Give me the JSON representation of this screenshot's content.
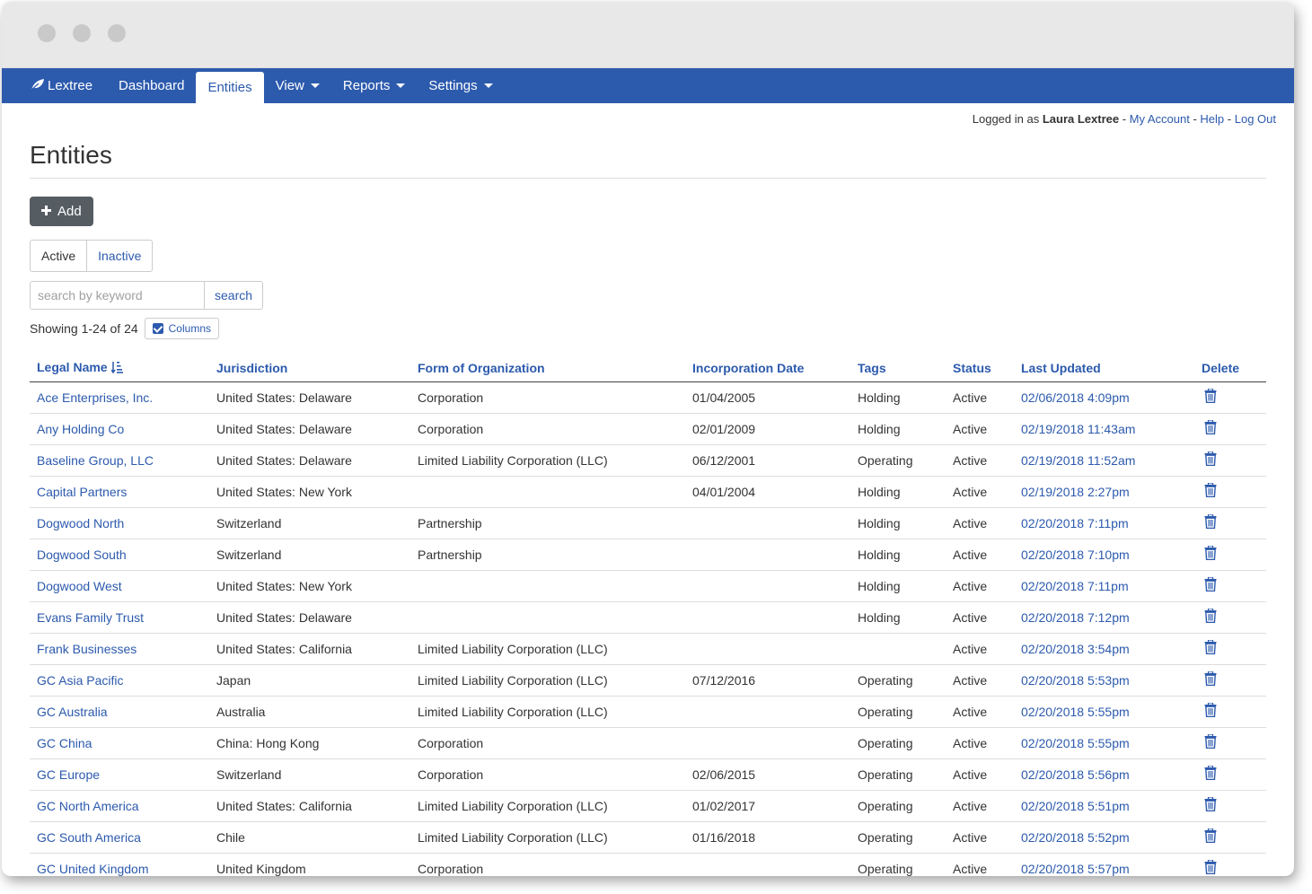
{
  "brand": {
    "name": "Lextree",
    "icon": "leaf-icon"
  },
  "nav": {
    "items": [
      {
        "label": "Dashboard",
        "dropdown": false,
        "active": false
      },
      {
        "label": "Entities",
        "dropdown": false,
        "active": true
      },
      {
        "label": "View",
        "dropdown": true,
        "active": false
      },
      {
        "label": "Reports",
        "dropdown": true,
        "active": false
      },
      {
        "label": "Settings",
        "dropdown": true,
        "active": false
      }
    ]
  },
  "userbar": {
    "prefix": "Logged in as",
    "user": "Laura Lextree",
    "sep1": " - ",
    "my_account": "My Account",
    "sep2": " - ",
    "help": "Help",
    "sep3": " - ",
    "logout": "Log Out"
  },
  "page": {
    "title": "Entities"
  },
  "toolbar": {
    "add_label": "Add",
    "filter_active": "Active",
    "filter_inactive": "Inactive",
    "search_placeholder": "search by keyword",
    "search_value": "",
    "search_button": "search",
    "showing": "Showing 1-24 of 24",
    "columns_label": "Columns"
  },
  "colors": {
    "primary": "#2c5aad",
    "add_button": "#555c62"
  },
  "table": {
    "headers": {
      "legal_name": "Legal Name",
      "jurisdiction": "Jurisdiction",
      "form": "Form of Organization",
      "incorporation_date": "Incorporation Date",
      "tags": "Tags",
      "status": "Status",
      "last_updated": "Last Updated",
      "delete": "Delete"
    },
    "rows": [
      {
        "name": "Ace Enterprises, Inc.",
        "jurisdiction": "United States: Delaware",
        "form": "Corporation",
        "date": "01/04/2005",
        "tags": "Holding",
        "status": "Active",
        "updated": "02/06/2018 4:09pm"
      },
      {
        "name": "Any Holding Co",
        "jurisdiction": "United States: Delaware",
        "form": "Corporation",
        "date": "02/01/2009",
        "tags": "Holding",
        "status": "Active",
        "updated": "02/19/2018 11:43am"
      },
      {
        "name": "Baseline Group, LLC",
        "jurisdiction": "United States: Delaware",
        "form": "Limited Liability Corporation (LLC)",
        "date": "06/12/2001",
        "tags": "Operating",
        "status": "Active",
        "updated": "02/19/2018 11:52am"
      },
      {
        "name": "Capital Partners",
        "jurisdiction": "United States: New York",
        "form": "",
        "date": "04/01/2004",
        "tags": "Holding",
        "status": "Active",
        "updated": "02/19/2018 2:27pm"
      },
      {
        "name": "Dogwood North",
        "jurisdiction": "Switzerland",
        "form": "Partnership",
        "date": "",
        "tags": "Holding",
        "status": "Active",
        "updated": "02/20/2018 7:11pm"
      },
      {
        "name": "Dogwood South",
        "jurisdiction": "Switzerland",
        "form": "Partnership",
        "date": "",
        "tags": "Holding",
        "status": "Active",
        "updated": "02/20/2018 7:10pm"
      },
      {
        "name": "Dogwood West",
        "jurisdiction": "United States: New York",
        "form": "",
        "date": "",
        "tags": "Holding",
        "status": "Active",
        "updated": "02/20/2018 7:11pm"
      },
      {
        "name": "Evans Family Trust",
        "jurisdiction": "United States: Delaware",
        "form": "",
        "date": "",
        "tags": "Holding",
        "status": "Active",
        "updated": "02/20/2018 7:12pm"
      },
      {
        "name": "Frank Businesses",
        "jurisdiction": "United States: California",
        "form": "Limited Liability Corporation (LLC)",
        "date": "",
        "tags": "",
        "status": "Active",
        "updated": "02/20/2018 3:54pm"
      },
      {
        "name": "GC Asia Pacific",
        "jurisdiction": "Japan",
        "form": "Limited Liability Corporation (LLC)",
        "date": "07/12/2016",
        "tags": "Operating",
        "status": "Active",
        "updated": "02/20/2018 5:53pm"
      },
      {
        "name": "GC Australia",
        "jurisdiction": "Australia",
        "form": "Limited Liability Corporation (LLC)",
        "date": "",
        "tags": "Operating",
        "status": "Active",
        "updated": "02/20/2018 5:55pm"
      },
      {
        "name": "GC China",
        "jurisdiction": "China: Hong Kong",
        "form": "Corporation",
        "date": "",
        "tags": "Operating",
        "status": "Active",
        "updated": "02/20/2018 5:55pm"
      },
      {
        "name": "GC Europe",
        "jurisdiction": "Switzerland",
        "form": "Corporation",
        "date": "02/06/2015",
        "tags": "Operating",
        "status": "Active",
        "updated": "02/20/2018 5:56pm"
      },
      {
        "name": "GC North America",
        "jurisdiction": "United States: California",
        "form": "Limited Liability Corporation (LLC)",
        "date": "01/02/2017",
        "tags": "Operating",
        "status": "Active",
        "updated": "02/20/2018 5:51pm"
      },
      {
        "name": "GC South America",
        "jurisdiction": "Chile",
        "form": "Limited Liability Corporation (LLC)",
        "date": "01/16/2018",
        "tags": "Operating",
        "status": "Active",
        "updated": "02/20/2018 5:52pm"
      },
      {
        "name": "GC United Kingdom",
        "jurisdiction": "United Kingdom",
        "form": "Corporation",
        "date": "",
        "tags": "Operating",
        "status": "Active",
        "updated": "02/20/2018 5:57pm"
      }
    ]
  }
}
